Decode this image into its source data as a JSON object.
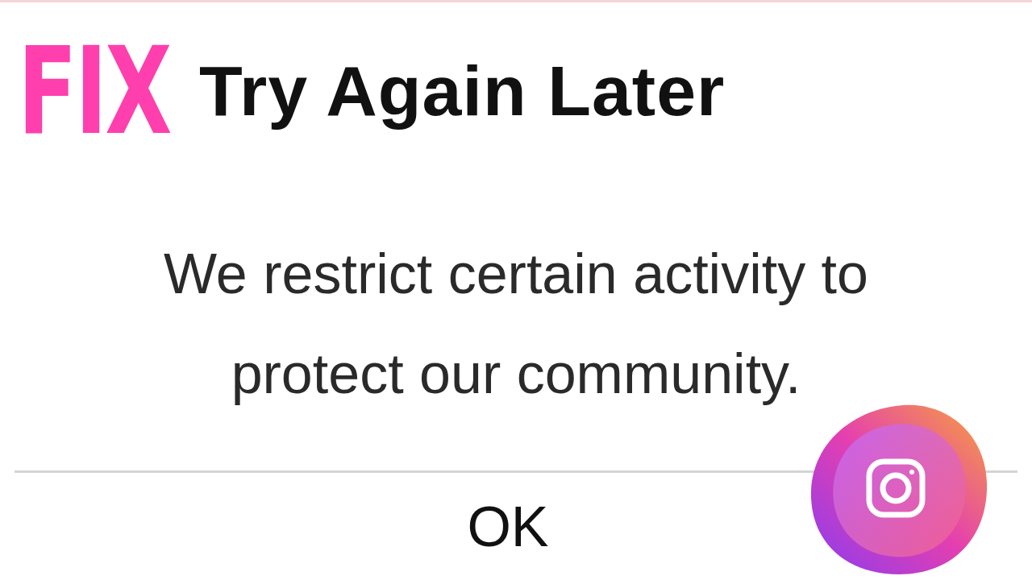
{
  "badge": "FIX",
  "dialog": {
    "title": "Try Again Later",
    "message": "We restrict certain activity to protect our community.",
    "buttons": [
      "OK"
    ]
  }
}
